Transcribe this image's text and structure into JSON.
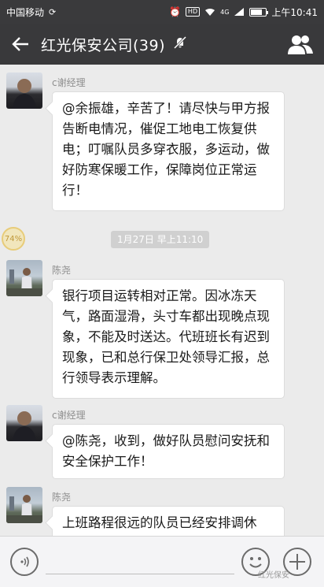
{
  "status_bar": {
    "carrier": "中国移动",
    "network": "4G",
    "hd": "HD",
    "time": "上午10:41"
  },
  "header": {
    "title": "红光保安公司(39)"
  },
  "messages": [
    {
      "sender": "c谢经理",
      "text": "@余振雄，辛苦了！请尽快与甲方报告断电情况，催促工地电工恢复供电；叮嘱队员多穿衣服，多运动，做好防寒保暖工作，保障岗位正常运行！"
    },
    {
      "sender": "陈尧",
      "text": "银行项目运转相对正常。因冰冻天气，路面湿滑，头寸车都出现晚点现象，不能及时送达。代班班长有迟到现象，已和总行保卫处领导汇报，总行领导表示理解。"
    },
    {
      "sender": "c谢经理",
      "text": "@陈尧，收到，做好队员慰问安抚和安全保护工作！"
    },
    {
      "sender": "陈尧",
      "text": "上班路程很远的队员已经安排调休"
    }
  ],
  "timestamp": "1月27日 早上11:10",
  "badge": "74%",
  "watermark": "红光保安"
}
